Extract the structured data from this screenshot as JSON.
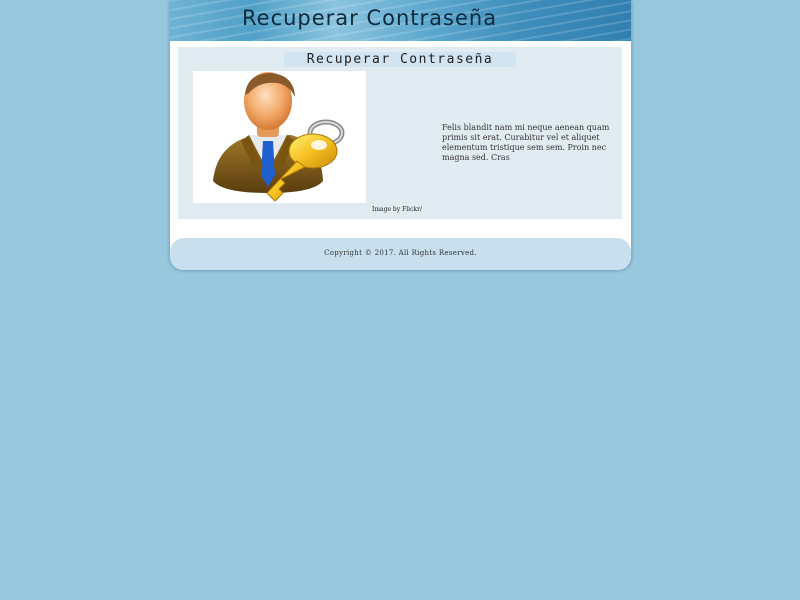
{
  "header": {
    "title": "Recuperar Contraseña"
  },
  "main": {
    "heading": "Recuperar Contraseña",
    "image": {
      "icon": "user-with-key-icon"
    },
    "caption": "Image by Flickr/",
    "body": "Felis blandit nam mi neque aenean quam primis sit erat. Curabitur vel et aliquet elementum tristique sem sem. Proin nec magna sed. Cras"
  },
  "footer": {
    "copyright": "Copyright © 2017. All Rights Reserved."
  },
  "colors": {
    "background": "#98c8de",
    "header_dark": "#2f7fb0",
    "content_box": "#e1ebf2",
    "footer": "#c8e0ed"
  }
}
